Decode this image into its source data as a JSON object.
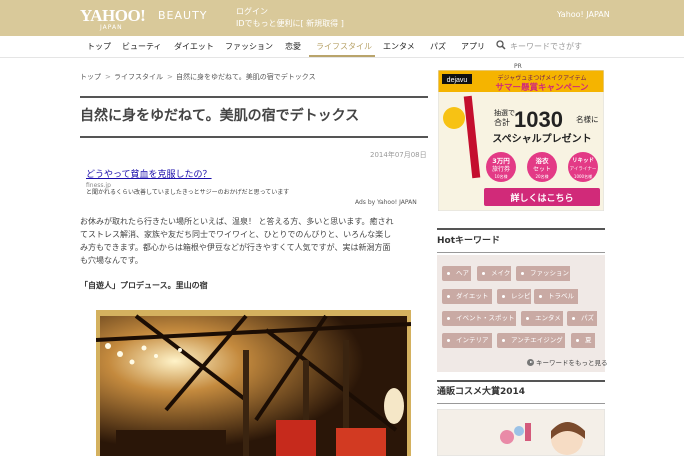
{
  "header": {
    "logo": "YAHOO!",
    "logo_sub": "JAPAN",
    "brand": "BEAUTY",
    "login": "ログイン",
    "id_promo": "IDでもっと便利に[ 新規取得 ]",
    "yahoo_japan": "Yahoo! JAPAN",
    "background_color": "#d9c99a"
  },
  "nav": {
    "items": [
      {
        "label": "トップ"
      },
      {
        "label": "ビューティ"
      },
      {
        "label": "ダイエット"
      },
      {
        "label": "ファッション"
      },
      {
        "label": "恋愛"
      },
      {
        "label": "ライフスタイル"
      },
      {
        "label": "エンタメ"
      },
      {
        "label": "パズ"
      },
      {
        "label": "アプリ"
      }
    ],
    "active": "ライフスタイル",
    "search_placeholder": "キーワードでさがす",
    "accent_color": "#b9a46b"
  },
  "breadcrumb": {
    "items": [
      "トップ",
      "ライフスタイル",
      "自然に身をゆだねて。美肌の宿でデトックス"
    ],
    "separator": ">"
  },
  "article": {
    "title": "自然に身をゆだねて。美肌の宿でデトックス",
    "date": "2014年07月08日",
    "ad": {
      "headline": "どうやって貧血を克服したの？",
      "domain": "finess.jp",
      "description": "と聞かれるくらい改善していましたきっとサジーのおかげだと思っています",
      "by": "Ads by Yahoo! JAPAN"
    },
    "paragraph_lines": [
      "お休みが取れたら行きたい場所といえば、温泉！ と答える方、多いと思います。癒され",
      "てストレス解消、家族や友だち同士でワイワイと、ひとりでのんびりと、いろんな楽し",
      "み方もできます。都心からは箱根や伊豆などが行きやすくて人気ですが、実は新潟方面",
      "も穴場なんです。"
    ],
    "subheading": "「自遊人」プロデュース。里山の宿"
  },
  "sidebar": {
    "pr": "PR",
    "banner": {
      "brand": "dejavu",
      "tagline": "デジャヴュまつげメイクアイテム",
      "campaign": "サマー懸賞キャンペーン",
      "lottery": "抽選で",
      "total": "合計",
      "count": "1030",
      "unit": "名様に",
      "present": "スペシャルプレゼント",
      "prize1": "3万円",
      "prize1_sub": "旅行券",
      "prize1_count": "10名様",
      "prize2": "浴衣",
      "prize2_sub": "セット",
      "prize2_count": "20名様",
      "prize3": "リキッド",
      "prize3_sub": "アイライナー",
      "prize3_count": "1000名様",
      "cta": "詳しくはこちら"
    },
    "hot_keywords": {
      "heading": "Hotキーワード",
      "tags": [
        "ヘア",
        "メイク",
        "ファッション",
        "ダイエット",
        "レシピ",
        "トラベル",
        "イベント・スポット",
        "エンタメ",
        "パズ",
        "インテリア",
        "アンチエイジング",
        "夏"
      ],
      "more": "キーワードをもっと見る"
    },
    "award": {
      "heading": "通販コスメ大賞2014"
    }
  }
}
